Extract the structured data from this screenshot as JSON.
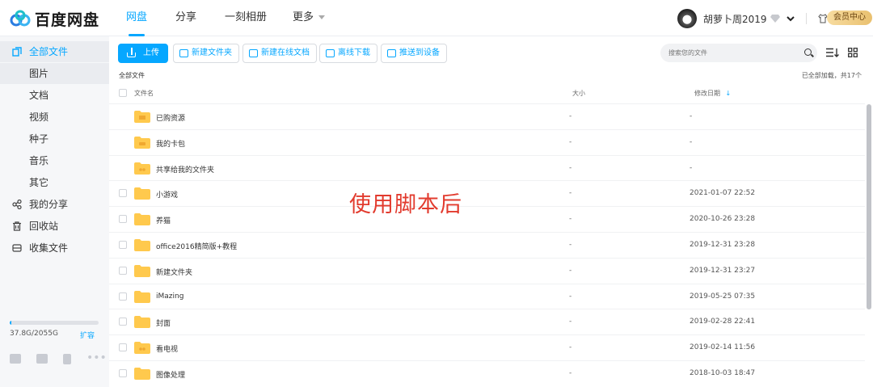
{
  "header": {
    "logo_text": "百度网盘",
    "nav": [
      {
        "label": "网盘",
        "active": true
      },
      {
        "label": "分享",
        "active": false
      },
      {
        "label": "一刻相册",
        "active": false
      },
      {
        "label": "更多",
        "active": false
      }
    ],
    "username": "胡萝卜周2019",
    "vip_label": "会员中心"
  },
  "sidebar": {
    "items": [
      {
        "label": "全部文件",
        "icon": "files-icon",
        "active": true
      },
      {
        "label": "图片",
        "sub": true
      },
      {
        "label": "文档",
        "sub": true
      },
      {
        "label": "视频",
        "sub": true
      },
      {
        "label": "种子",
        "sub": true
      },
      {
        "label": "音乐",
        "sub": true
      },
      {
        "label": "其它",
        "sub": true
      },
      {
        "label": "我的分享",
        "icon": "share-icon"
      },
      {
        "label": "回收站",
        "icon": "trash-icon"
      },
      {
        "label": "收集文件",
        "icon": "collect-icon"
      }
    ],
    "quota_text": "37.8G/2055G",
    "quota_fraction": 0.018,
    "expand_label": "扩容"
  },
  "toolbar": {
    "upload": "上传",
    "new_folder": "新建文件夹",
    "new_online_doc": "新建在线文档",
    "offline_download": "离线下载",
    "push_device": "推送到设备",
    "search_placeholder": "搜索您的文件"
  },
  "breadcrumb": "全部文件",
  "load_status": "已全部加载，共17个",
  "table": {
    "headers": {
      "name": "文件名",
      "size": "大小",
      "date": "修改日期"
    },
    "rows": [
      {
        "name": "已购资源",
        "size": "-",
        "date": "-",
        "kind": "purchased"
      },
      {
        "name": "我的卡包",
        "size": "-",
        "date": "-",
        "kind": "card"
      },
      {
        "name": "共享给我的文件夹",
        "size": "-",
        "date": "-",
        "kind": "shared"
      },
      {
        "name": "小游戏",
        "size": "-",
        "date": "2021-01-07 22:52",
        "kind": "folder"
      },
      {
        "name": "养猫",
        "size": "-",
        "date": "2020-10-26 23:28",
        "kind": "folder"
      },
      {
        "name": "office2016精简版+教程",
        "size": "-",
        "date": "2019-12-31 23:28",
        "kind": "folder"
      },
      {
        "name": "新建文件夹",
        "size": "-",
        "date": "2019-12-31 23:27",
        "kind": "folder"
      },
      {
        "name": "iMazing",
        "size": "-",
        "date": "2019-05-25 07:35",
        "kind": "folder"
      },
      {
        "name": "封面",
        "size": "-",
        "date": "2019-02-28 22:41",
        "kind": "folder"
      },
      {
        "name": "看电视",
        "size": "-",
        "date": "2019-02-14 11:56",
        "kind": "shared"
      },
      {
        "name": "图像处理",
        "size": "-",
        "date": "2018-10-03 18:47",
        "kind": "folder"
      }
    ]
  },
  "overlay_text": "使用脚本后",
  "colors": {
    "accent": "#06a7ff",
    "folder": "#ffc94d",
    "overlay": "#e23b2e"
  }
}
